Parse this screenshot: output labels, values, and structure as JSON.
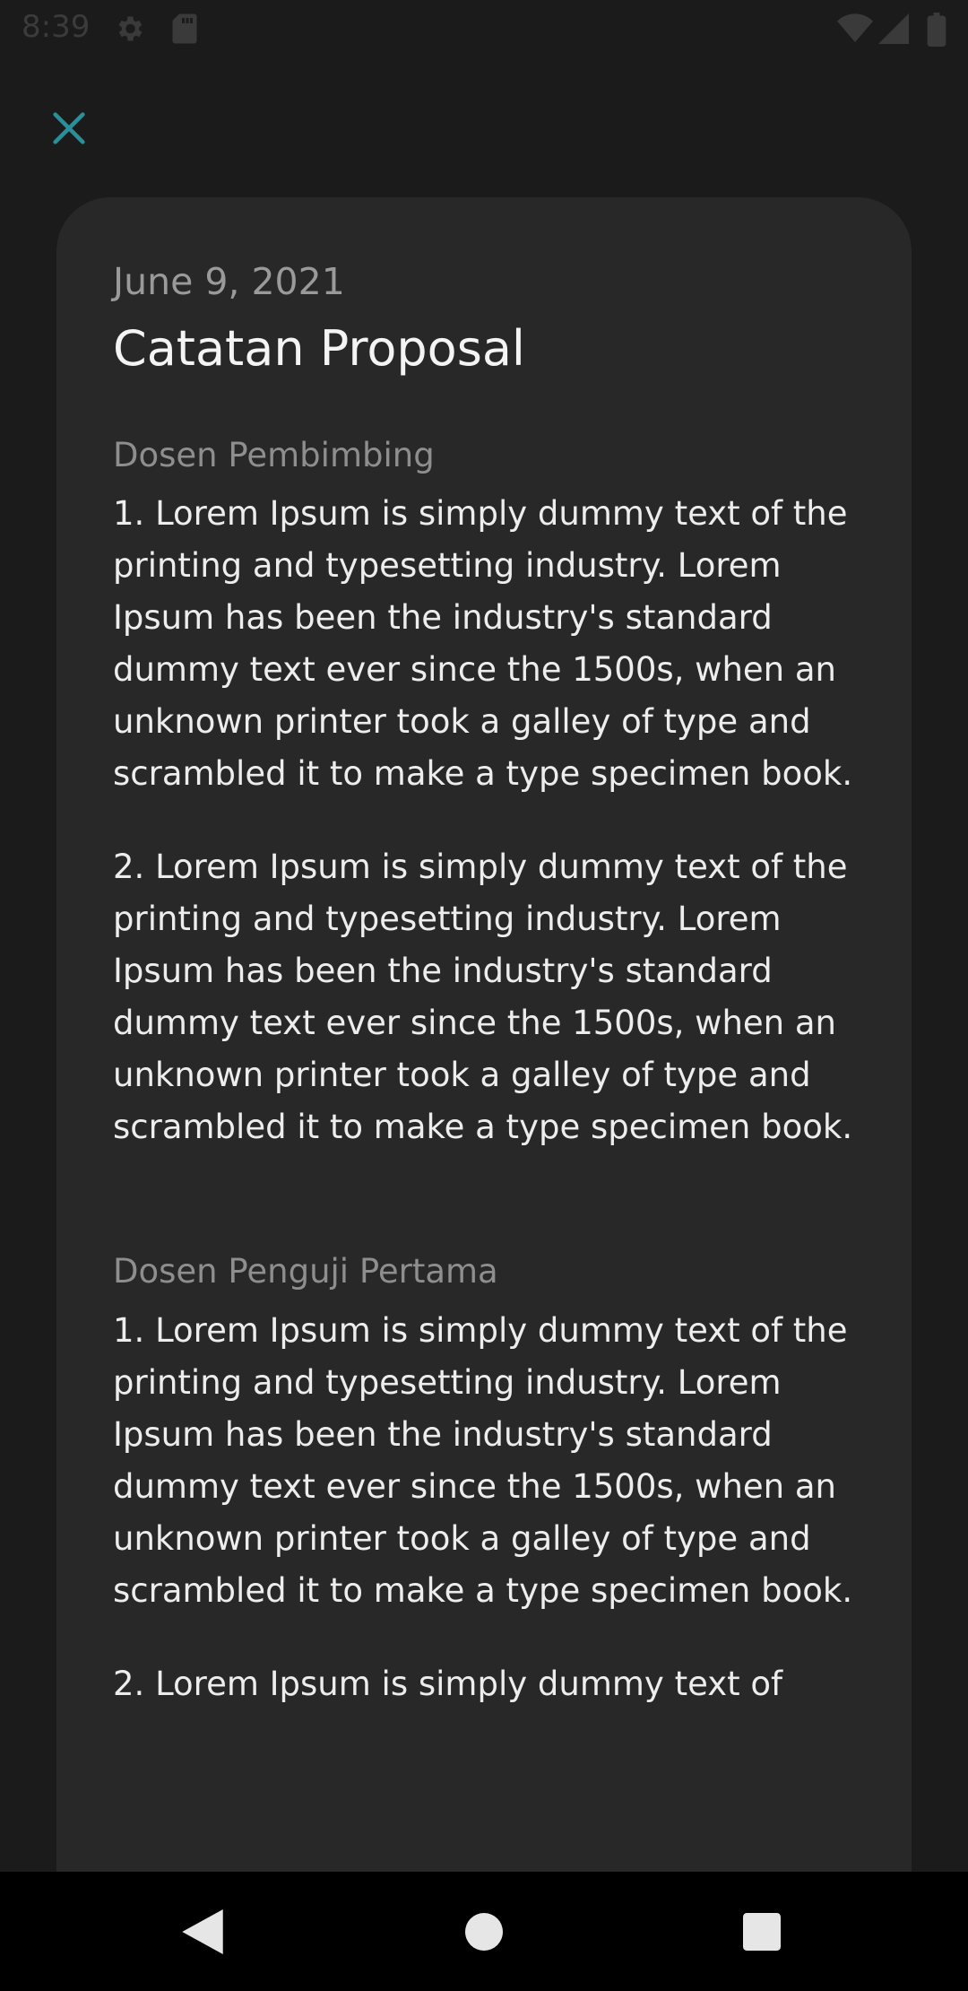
{
  "status_bar": {
    "time": "8:39",
    "icons": [
      "gear-icon",
      "sd-card-icon",
      "wifi-icon",
      "cell-signal-icon",
      "battery-icon"
    ]
  },
  "colors": {
    "background": "#1b1b1b",
    "card": "#282829",
    "accent": "#2b8f99",
    "title": "#f4f4f4",
    "muted": "#9a9a9a",
    "nav_bar": "#000000"
  },
  "header": {
    "close_icon": "close-icon"
  },
  "note": {
    "date": "June 9, 2021",
    "title": "Catatan Proposal",
    "sections": [
      {
        "label": "Dosen Pembimbing",
        "items": [
          "1. Lorem Ipsum is simply dummy text of the printing and typesetting industry. Lorem Ipsum has been the industry's standard dummy text ever since the 1500s, when an unknown printer took a galley of type and scrambled it to make a type specimen book.",
          "2. Lorem Ipsum is simply dummy text of the printing and typesetting industry. Lorem Ipsum has been the industry's standard dummy text ever since the 1500s, when an unknown printer took a galley of type and scrambled it to make a type specimen book."
        ]
      },
      {
        "label": "Dosen Penguji Pertama",
        "items": [
          "1. Lorem Ipsum is simply dummy text of the printing and typesetting industry. Lorem Ipsum has been the industry's standard dummy text ever since the 1500s, when an unknown printer took a galley of type and scrambled it to make a type specimen book.",
          "2. Lorem Ipsum is simply dummy text of"
        ]
      }
    ]
  },
  "nav_bar": {
    "buttons": [
      "back-icon",
      "home-icon",
      "recents-icon"
    ]
  }
}
